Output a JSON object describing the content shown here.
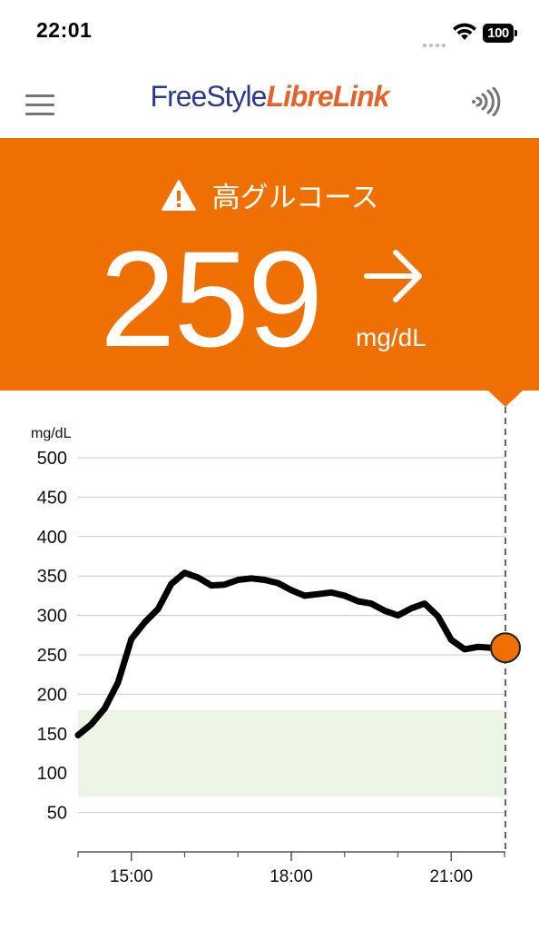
{
  "status_bar": {
    "time": "22:01",
    "battery": "100"
  },
  "header": {
    "brand_part1": "FreeStyle",
    "brand_part2": "LibreLink"
  },
  "alert": {
    "title": "高グルコース",
    "value": "259",
    "unit": "mg/dL",
    "trend": "steady",
    "background_color": "#ef7000"
  },
  "icons": {
    "menu": "hamburger-menu-icon",
    "scan": "nfc-scan-icon",
    "warning": "warning-triangle-icon",
    "trend": "arrow-right-icon"
  },
  "chart_data": {
    "type": "line",
    "ylabel": "mg/dL",
    "ylim": [
      0,
      500
    ],
    "yticks": [
      50,
      100,
      150,
      200,
      250,
      300,
      350,
      400,
      450,
      500
    ],
    "xtick_labels": [
      "15:00",
      "18:00",
      "21:00"
    ],
    "grid": true,
    "target_range": [
      70,
      180
    ],
    "target_range_color": "#edf5e6",
    "line_color": "#000000",
    "current_point": {
      "x": "22:01",
      "y": 259,
      "color": "#ef7000"
    },
    "series": [
      {
        "x": [
          "14:00",
          "14:15",
          "14:30",
          "14:45",
          "15:00",
          "15:15",
          "15:30",
          "15:45",
          "16:00",
          "16:15",
          "16:30",
          "16:45",
          "17:00",
          "17:15",
          "17:30",
          "17:45",
          "18:00",
          "18:15",
          "18:30",
          "18:45",
          "19:00",
          "19:15",
          "19:30",
          "19:45",
          "20:00",
          "20:15",
          "20:30",
          "20:45",
          "21:00",
          "21:15",
          "21:30",
          "21:45",
          "22:01"
        ],
        "y": [
          148,
          162,
          182,
          215,
          270,
          291,
          308,
          340,
          354,
          348,
          338,
          339,
          345,
          347,
          345,
          341,
          332,
          325,
          327,
          329,
          325,
          318,
          315,
          306,
          300,
          309,
          315,
          299,
          269,
          257,
          260,
          259,
          259
        ]
      }
    ]
  }
}
